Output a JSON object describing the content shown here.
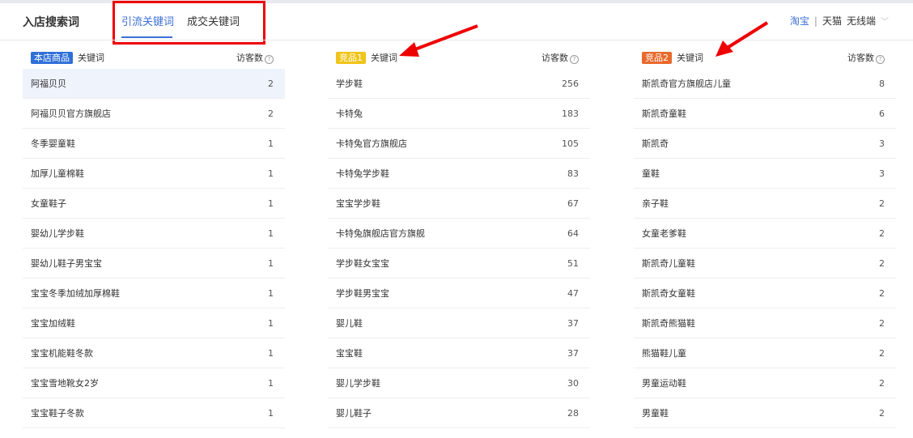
{
  "header": {
    "title": "入店搜索词",
    "tabs": [
      {
        "label": "引流关键词",
        "active": true
      },
      {
        "label": "成交关键词",
        "active": false
      }
    ],
    "platform": {
      "taobao": "淘宝",
      "sep": "|",
      "tmall": "天猫",
      "device": "无线端"
    }
  },
  "columns": [
    {
      "badge": "本店商品",
      "badge_color": "#2f6fd8",
      "keyword_label": "关键词",
      "visitors_label": "访客数",
      "help": "?",
      "rows": [
        [
          "阿福贝贝",
          "2"
        ],
        [
          "阿福贝贝官方旗舰店",
          "2"
        ],
        [
          "冬季婴童鞋",
          "1"
        ],
        [
          "加厚儿童棉鞋",
          "1"
        ],
        [
          "女童鞋子",
          "1"
        ],
        [
          "婴幼儿学步鞋",
          "1"
        ],
        [
          "婴幼儿鞋子男宝宝",
          "1"
        ],
        [
          "宝宝冬季加绒加厚棉鞋",
          "1"
        ],
        [
          "宝宝加绒鞋",
          "1"
        ],
        [
          "宝宝机能鞋冬款",
          "1"
        ],
        [
          "宝宝雪地靴女2岁",
          "1"
        ],
        [
          "宝宝鞋子冬款",
          "1"
        ]
      ]
    },
    {
      "badge": "竞品1",
      "badge_color": "#f0c419",
      "keyword_label": "关键词",
      "visitors_label": "访客数",
      "help": "?",
      "rows": [
        [
          "学步鞋",
          "256"
        ],
        [
          "卡特兔",
          "183"
        ],
        [
          "卡特兔官方旗舰店",
          "105"
        ],
        [
          "卡特兔学步鞋",
          "83"
        ],
        [
          "宝宝学步鞋",
          "67"
        ],
        [
          "卡特兔旗舰店官方旗舰",
          "64"
        ],
        [
          "学步鞋女宝宝",
          "51"
        ],
        [
          "学步鞋男宝宝",
          "47"
        ],
        [
          "婴儿鞋",
          "37"
        ],
        [
          "宝宝鞋",
          "37"
        ],
        [
          "婴儿学步鞋",
          "30"
        ],
        [
          "婴儿鞋子",
          "28"
        ]
      ]
    },
    {
      "badge": "竞品2",
      "badge_color": "#e8692c",
      "keyword_label": "关键词",
      "visitors_label": "访客数",
      "help": "?",
      "rows": [
        [
          "斯凯奇官方旗舰店儿童",
          "8"
        ],
        [
          "斯凯奇童鞋",
          "6"
        ],
        [
          "斯凯奇",
          "3"
        ],
        [
          "童鞋",
          "3"
        ],
        [
          "亲子鞋",
          "2"
        ],
        [
          "女童老爹鞋",
          "2"
        ],
        [
          "斯凯奇儿童鞋",
          "2"
        ],
        [
          "斯凯奇女童鞋",
          "2"
        ],
        [
          "斯凯奇熊猫鞋",
          "2"
        ],
        [
          "熊猫鞋儿童",
          "2"
        ],
        [
          "男童运动鞋",
          "2"
        ],
        [
          "男童鞋",
          "2"
        ]
      ]
    }
  ]
}
